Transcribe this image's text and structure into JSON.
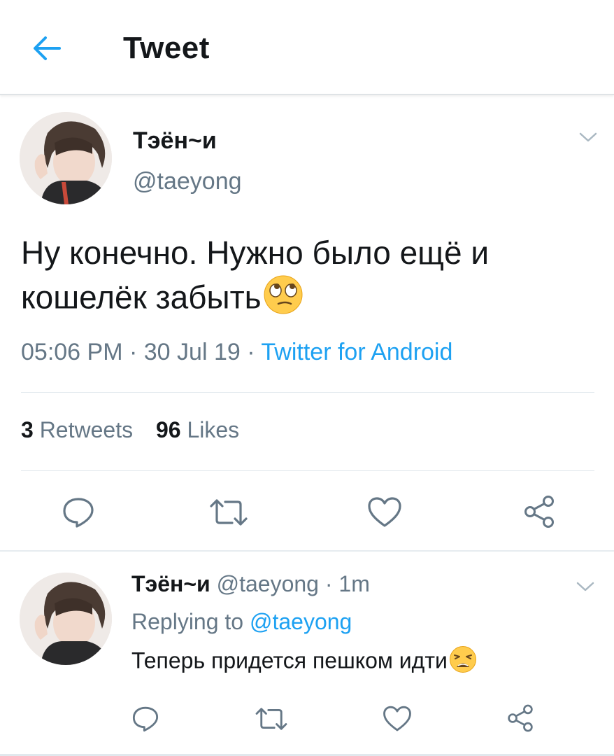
{
  "header": {
    "title": "Tweet",
    "back_icon": "arrow-left-icon",
    "accent": "#1da1f2"
  },
  "tweet": {
    "author_name": "Тэён~и",
    "author_handle": "@taeyong",
    "text_line1": "Ну конечно. Нужно было ещё и",
    "text_line2": "кошелёк забыть",
    "emoji": "face-with-rolling-eyes",
    "time": "05:06 PM",
    "date": "30 Jul 19",
    "meta_sep": "·",
    "source": "Twitter for Android",
    "retweets_count": "3",
    "retweets_label": "Retweets",
    "likes_count": "96",
    "likes_label": "Likes"
  },
  "actions": [
    "reply-icon",
    "retweet-icon",
    "like-icon",
    "share-icon"
  ],
  "reply": {
    "author_name": "Тэён~и",
    "author_handle": "@taeyong",
    "age": "1m",
    "meta_sep": "·",
    "replying_label": "Replying to",
    "replying_to": "@taeyong",
    "text": "Теперь придется пешком идти",
    "emoji": "weary-face"
  },
  "colors": {
    "text": "#14171a",
    "secondary": "#657786",
    "link": "#1da1f2",
    "divider": "#e1e8ed"
  }
}
